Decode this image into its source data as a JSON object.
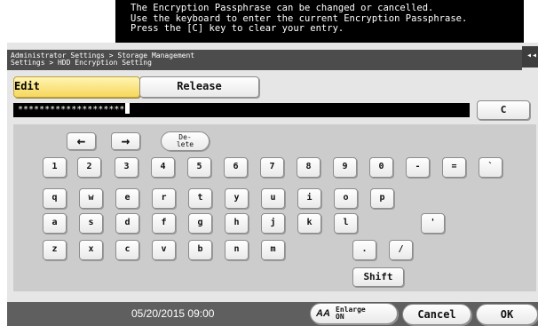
{
  "message": "The Encryption Passphrase can be changed or cancelled.\nUse the keyboard to enter the current Encryption Passphrase.\nPress the [C] key to clear your entry.",
  "breadcrumb": "Administrator Settings > Storage Management\nSettings > HDD Encryption Setting",
  "back_tab": "◂◂",
  "tabs": {
    "edit": "Edit",
    "release": "Release"
  },
  "entry_value": "********************",
  "clear_label": "C",
  "keys": {
    "arrow_left": "←",
    "arrow_right": "→",
    "delete": "De-\nlete",
    "row1": [
      "1",
      "2",
      "3",
      "4",
      "5",
      "6",
      "7",
      "8",
      "9",
      "0",
      "-",
      "=",
      "`"
    ],
    "row2": [
      "q",
      "w",
      "e",
      "r",
      "t",
      "y",
      "u",
      "i",
      "o",
      "p"
    ],
    "row3": [
      "a",
      "s",
      "d",
      "f",
      "g",
      "h",
      "j",
      "k",
      "l",
      "'"
    ],
    "row4": [
      "z",
      "x",
      "c",
      "v",
      "b",
      "n",
      "m",
      ".",
      "/"
    ],
    "shift": "Shift"
  },
  "footer": {
    "datetime": "05/20/2015  09:00",
    "enlarge": "Enlarge\nON",
    "enlarge_icon": "AA",
    "cancel": "Cancel",
    "ok": "OK"
  }
}
